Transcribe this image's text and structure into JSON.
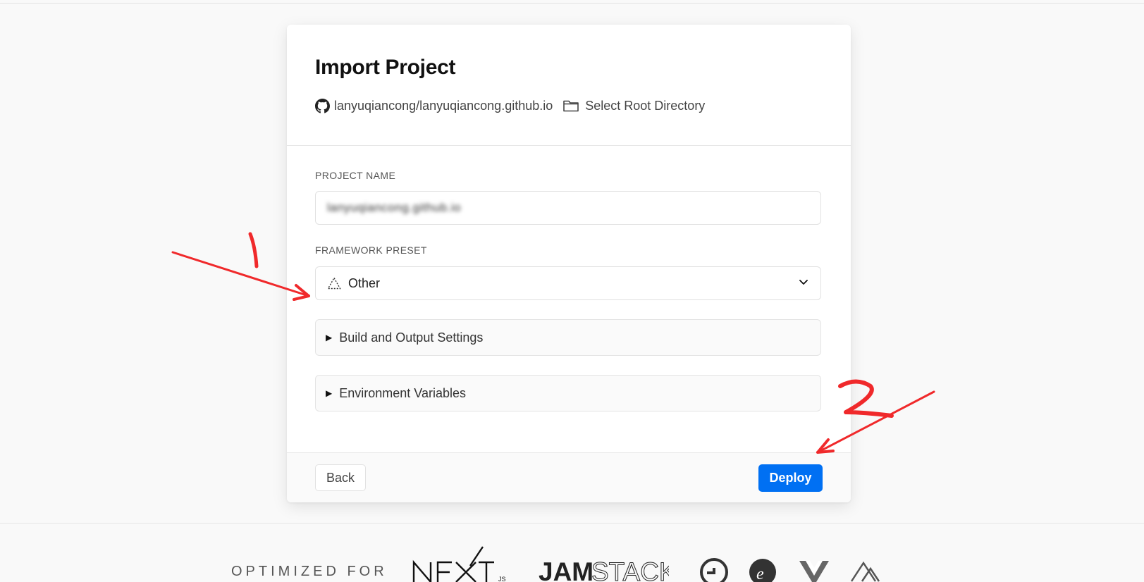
{
  "header": {
    "title": "Import Project",
    "repo": "lanyuqiancong/lanyuqiancong.github.io",
    "root_directory_label": "Select Root Directory"
  },
  "form": {
    "project_name_label": "PROJECT NAME",
    "project_name_value": "lanyuqiancong.github.io",
    "framework_label": "FRAMEWORK PRESET",
    "framework_value": "Other",
    "build_settings_label": "Build and Output Settings",
    "env_vars_label": "Environment Variables"
  },
  "actions": {
    "back_label": "Back",
    "deploy_label": "Deploy"
  },
  "footer": {
    "optimized_label": "OPTIMIZED FOR",
    "logos": [
      "next-js-logo",
      "jamstack-logo",
      "gatsby-logo",
      "eleventy-logo",
      "vue-logo",
      "nuxt-logo"
    ]
  },
  "annotations": {
    "step_1": "1",
    "step_2": "2",
    "color": "#f0292b"
  },
  "colors": {
    "primary": "#0070f3",
    "background": "#f9f9f9"
  }
}
